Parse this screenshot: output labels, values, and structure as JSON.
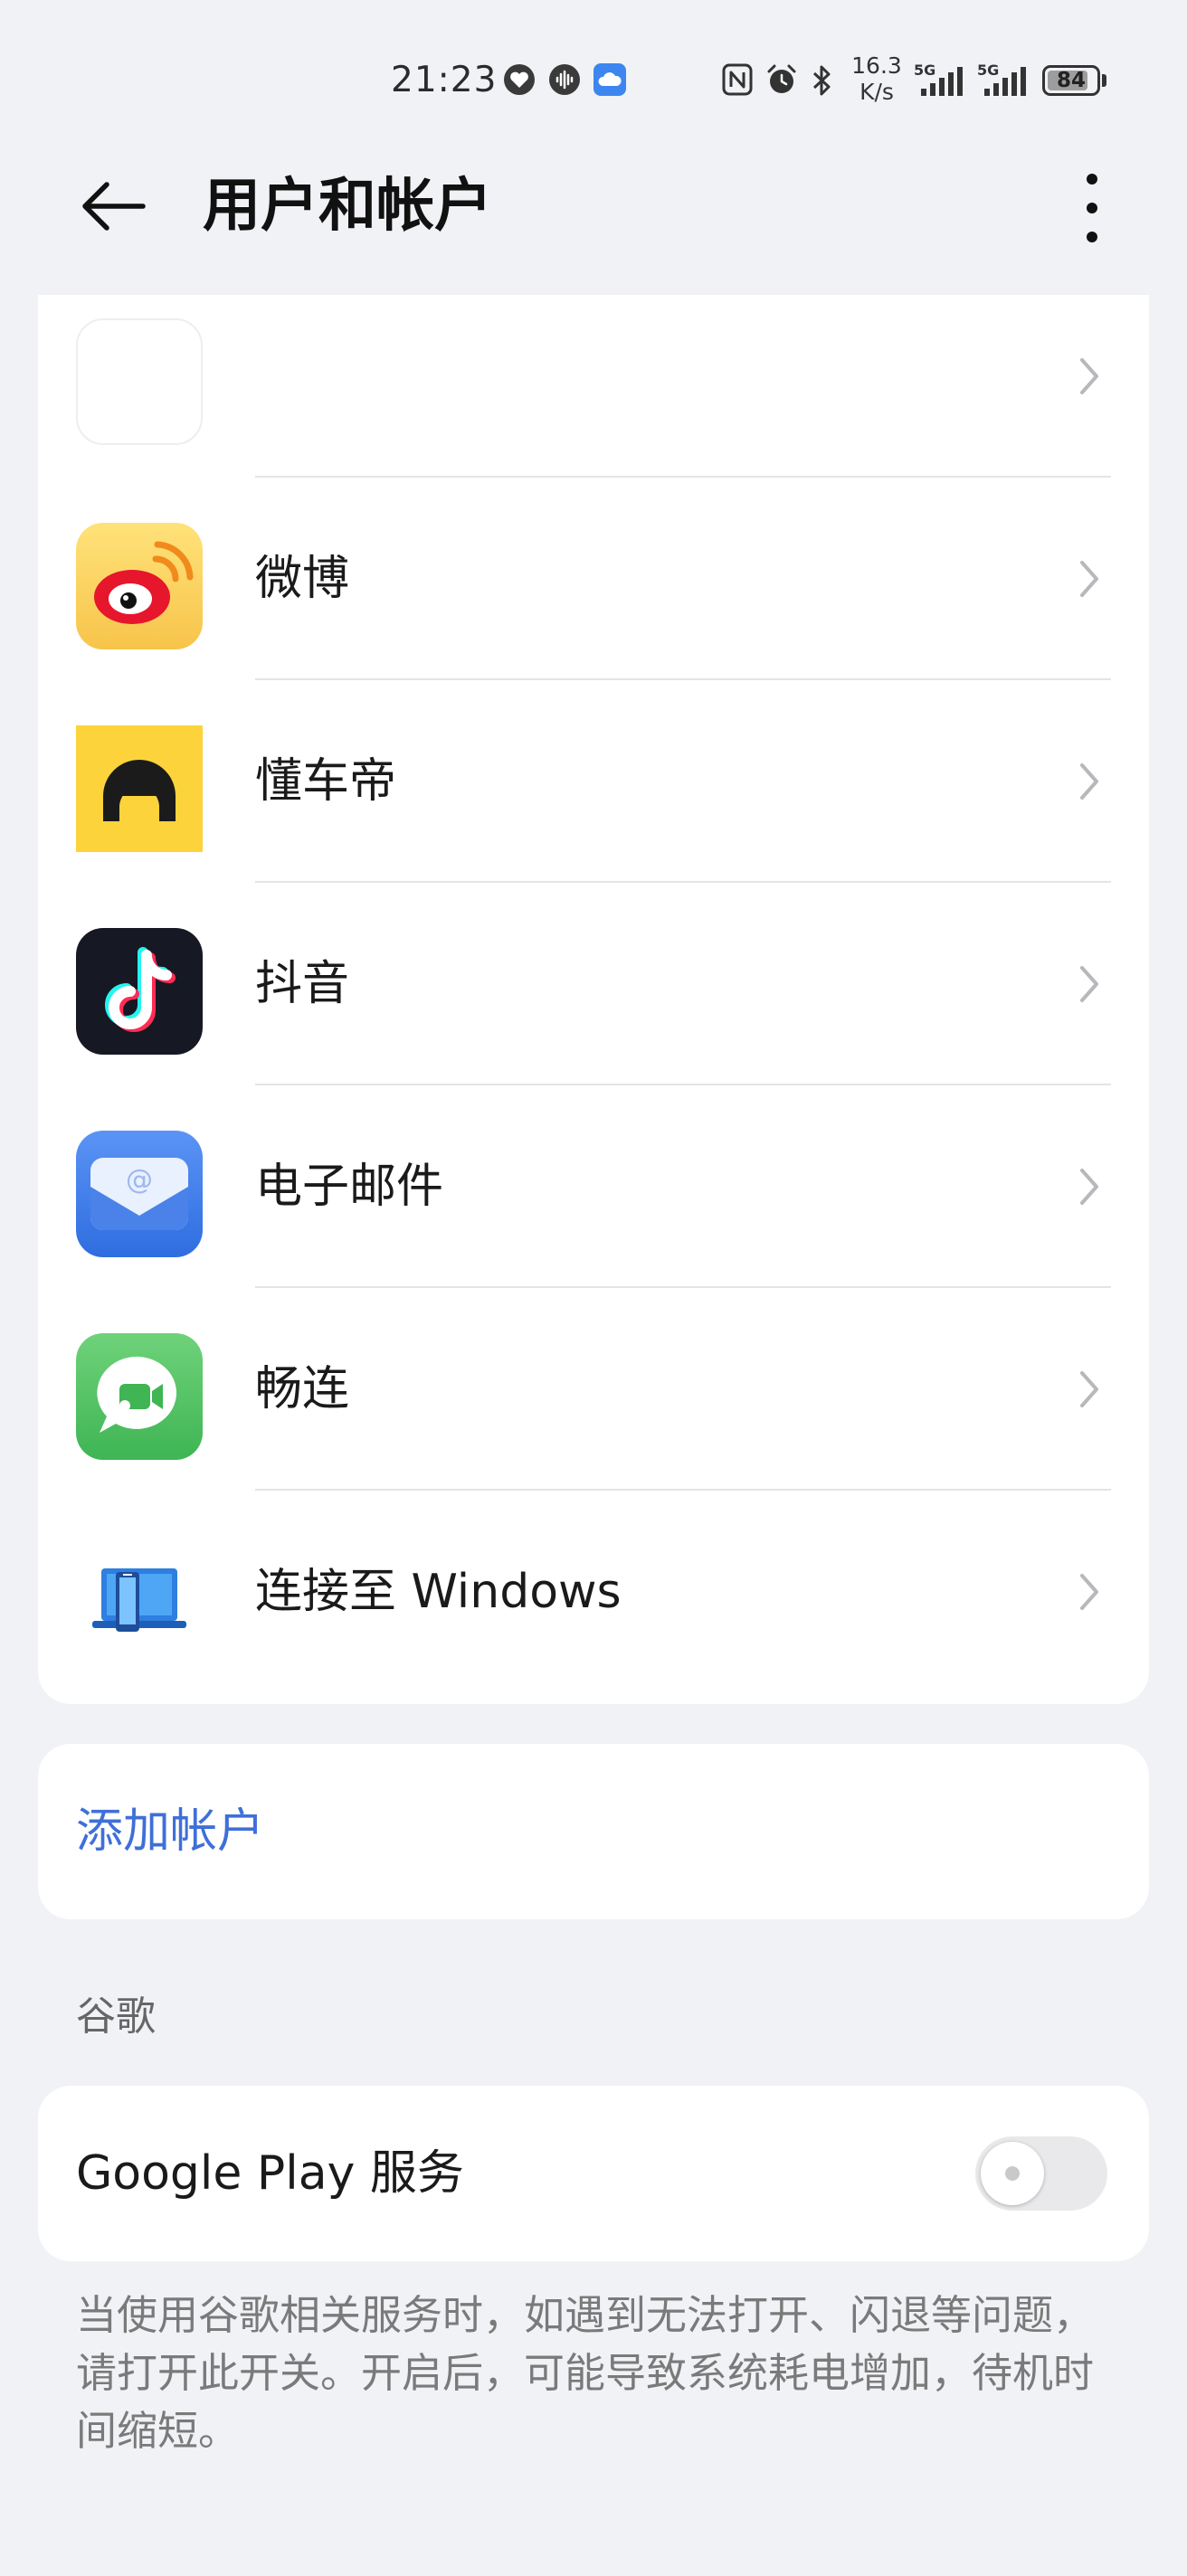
{
  "status_bar": {
    "time": "21:23",
    "net_speed_value": "16.3",
    "net_speed_unit": "K/s",
    "sim1_label": "5G",
    "sim2_label": "5G",
    "battery": "84",
    "battery_level": 0.84,
    "icons": [
      "heart-icon",
      "voice-assistant-icon",
      "cloud-icon",
      "nfc-icon",
      "alarm-icon",
      "bluetooth-icon",
      "signal-icon",
      "battery-icon"
    ]
  },
  "header": {
    "title": "用户和帐户",
    "back_icon": "arrow-left-icon",
    "more_icon": "more-vertical-icon"
  },
  "accounts": [
    {
      "label": "",
      "icon": "blank-app-icon"
    },
    {
      "label": "微博",
      "icon": "weibo-icon"
    },
    {
      "label": "懂车帝",
      "icon": "dongchedi-icon"
    },
    {
      "label": "抖音",
      "icon": "douyin-icon"
    },
    {
      "label": "电子邮件",
      "icon": "email-icon"
    },
    {
      "label": "畅连",
      "icon": "changlian-icon"
    },
    {
      "label": "连接至 Windows",
      "icon": "connect-windows-icon"
    }
  ],
  "add_account": {
    "label": "添加帐户",
    "color": "#3f6fd8"
  },
  "google_section": {
    "title": "谷歌",
    "service_label": "Google Play 服务",
    "enabled": false,
    "note": "当使用谷歌相关服务时，如遇到无法打开、闪退等问题，请打开此开关。开启后，可能导致系统耗电增加，待机时间缩短。"
  },
  "colors": {
    "background": "#f1f2f6",
    "card": "#ffffff",
    "accent": "#3f6fd8"
  }
}
